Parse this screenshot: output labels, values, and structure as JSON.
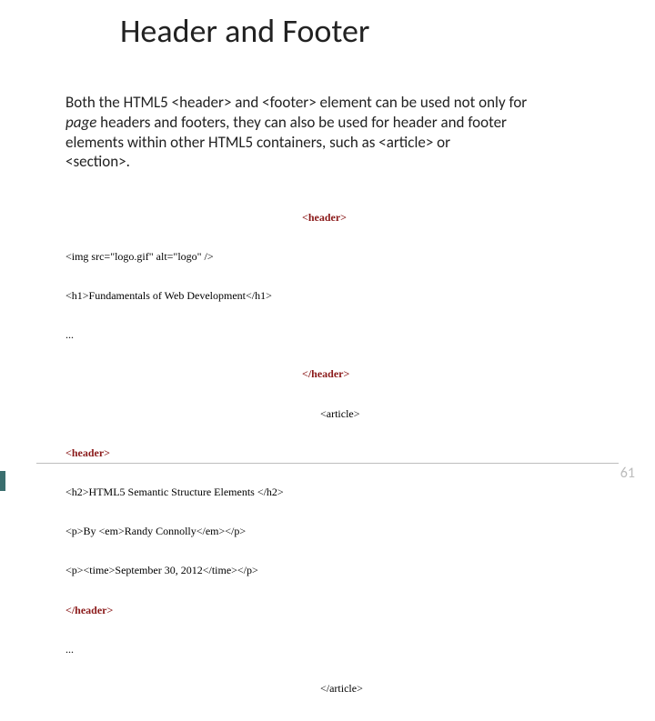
{
  "title": "Header and Footer",
  "paragraph": {
    "p1": "Both the HTML5 <header> and <footer> element can be used not only for ",
    "italic": "page",
    "p2": " headers and footers, they can also be used for header and footer elements within other HTML5 containers, such as <article> or",
    "p3": "<section>."
  },
  "code": {
    "l1": "<header>",
    "l2a": "<img src=\"logo.gif\" alt=\"logo\" />",
    "l3a": "<h1>Fundamentals of Web Development</h1>",
    "l4a": "...",
    "l5": "</header>",
    "l6": "<article>",
    "l7": "<header>",
    "l8a": "<h2>HTML5 Semantic Structure Elements </h2>",
    "l9a": "<p>By <em>Randy Connolly</em></p>",
    "l10a": "<p><time>September 30, 2012</time></p>",
    "l11": "</header>",
    "l12a": "...",
    "l13": "</article>"
  },
  "pageNumber": "61"
}
